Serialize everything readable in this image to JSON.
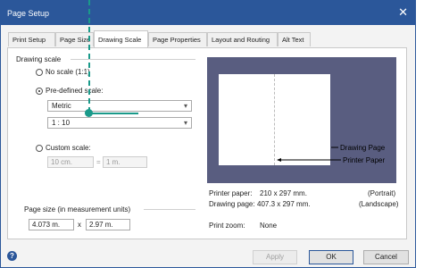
{
  "window": {
    "title": "Page Setup"
  },
  "tabs": [
    {
      "label": "Print Setup"
    },
    {
      "label": "Page Size"
    },
    {
      "label": "Drawing Scale"
    },
    {
      "label": "Page Properties"
    },
    {
      "label": "Layout and Routing"
    },
    {
      "label": "Alt Text"
    }
  ],
  "drawing_scale": {
    "heading": "Drawing scale",
    "no_scale_label": "No scale (1:1)",
    "predefined_label": "Pre-defined scale:",
    "predefined_type": "Metric",
    "predefined_value": "1 : 10",
    "custom_label": "Custom scale:",
    "custom_left": "10 cm.",
    "custom_equals": "=",
    "custom_right": "1 m."
  },
  "page_size": {
    "heading": "Page size (in measurement units)",
    "width": "4.073 m.",
    "x": "x",
    "height": "2.97 m."
  },
  "preview": {
    "drawing_page_label": "Drawing Page",
    "printer_paper_label": "Printer Paper"
  },
  "info": {
    "printer_paper_label": "Printer paper:",
    "printer_paper_value": "210 x 297 mm.",
    "printer_paper_orientation": "(Portrait)",
    "drawing_page_label": "Drawing page:",
    "drawing_page_value": "407.3 x 297 mm.",
    "drawing_page_orientation": "(Landscape)",
    "print_zoom_label": "Print zoom:",
    "print_zoom_value": "None"
  },
  "buttons": {
    "apply": "Apply",
    "ok": "OK",
    "cancel": "Cancel",
    "help": "?",
    "close": "✕"
  },
  "colors": {
    "title_bar": "#2b579a",
    "preview_bg": "#595d80",
    "annotation": "#1a9a8a"
  }
}
